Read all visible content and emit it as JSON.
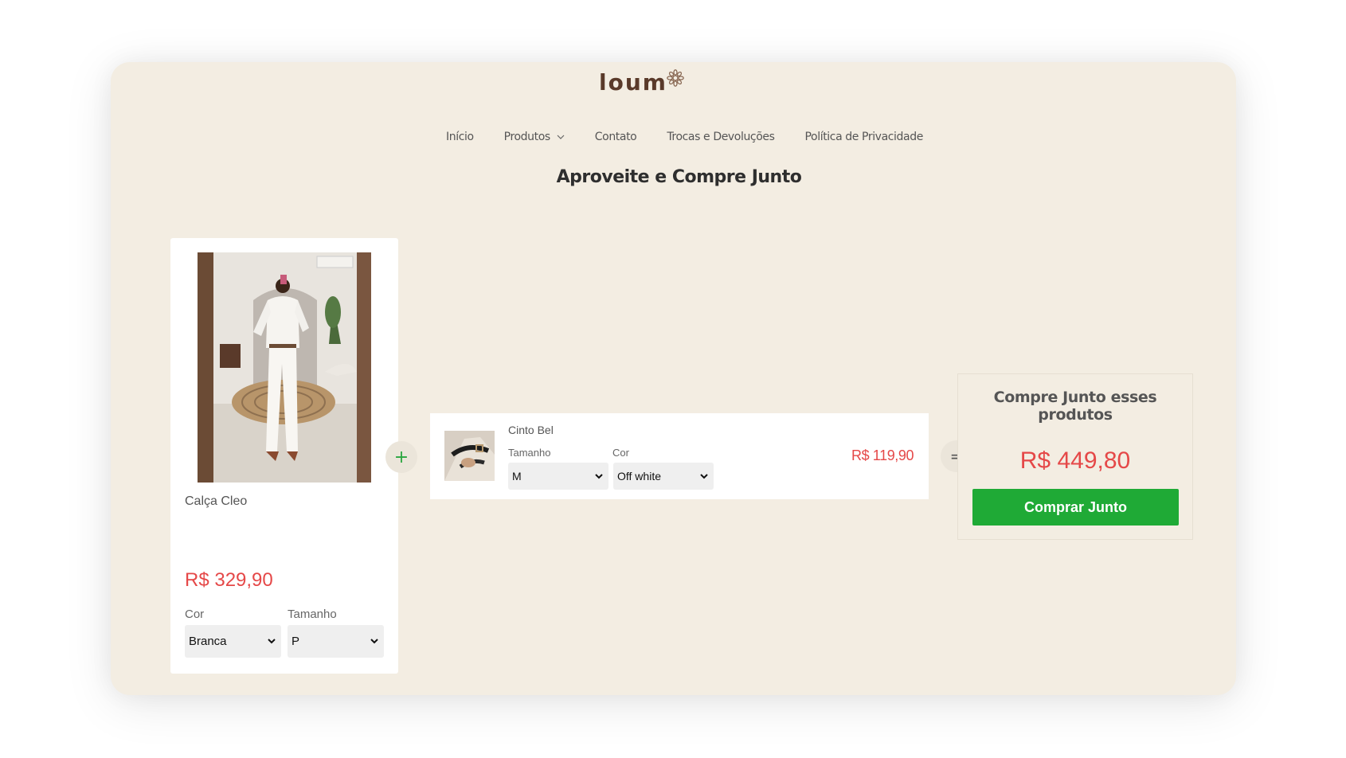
{
  "brand": {
    "logo_text": "Loum"
  },
  "nav": {
    "items": [
      {
        "label": "Início"
      },
      {
        "label": "Produtos"
      },
      {
        "label": "Contato"
      },
      {
        "label": "Trocas e Devoluções"
      },
      {
        "label": "Política de Privacidade"
      }
    ]
  },
  "page": {
    "title": "Aproveite e Compre Junto"
  },
  "main_product": {
    "name": "Calça Cleo",
    "price": "R$ 329,90",
    "color_label": "Cor",
    "color_value": "Branca",
    "size_label": "Tamanho",
    "size_value": "P"
  },
  "bundle_item": {
    "name": "Cinto Bel",
    "size_label": "Tamanho",
    "size_value": "M",
    "color_label": "Cor",
    "color_value": "Off white",
    "price": "R$ 119,90"
  },
  "operators": {
    "plus": "+",
    "equals": "="
  },
  "summary": {
    "title": "Compre Junto esses produtos",
    "total": "R$ 449,80",
    "button_label": "Comprar Junto"
  },
  "colors": {
    "background": "#f3ede2",
    "price": "#e54848",
    "button": "#1faa36",
    "plus": "#2aa640"
  }
}
